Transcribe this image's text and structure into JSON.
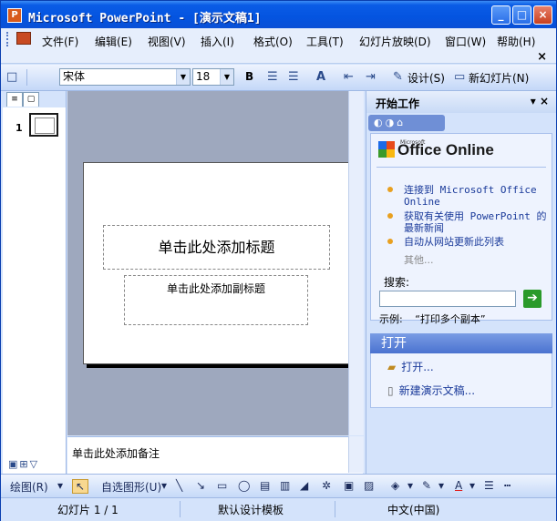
{
  "window": {
    "title": "Microsoft PowerPoint - [演示文稿1]",
    "app_icon": "powerpoint-icon",
    "controls": {
      "minimize": "_",
      "maximize": "□",
      "close": "×"
    }
  },
  "menubar": {
    "items": [
      "文件(F)",
      "编辑(E)",
      "视图(V)",
      "插入(I)",
      "格式(O)",
      "工具(T)",
      "幻灯片放映(D)",
      "窗口(W)",
      "帮助(H)"
    ],
    "close_doc": "×"
  },
  "toolbar": {
    "font_name": "宋体",
    "font_size": "18",
    "bold": "B",
    "design_label": "设计(S)",
    "new_slide_label": "新幻灯片(N)"
  },
  "slides_panel": {
    "slide_number": "1"
  },
  "slide": {
    "title_placeholder": "单击此处添加标题",
    "subtitle_placeholder": "单击此处添加副标题"
  },
  "notes": {
    "placeholder": "单击此处添加备注"
  },
  "task_pane": {
    "title": "开始工作",
    "logo_small": "Microsoft",
    "logo": "Office Online",
    "links": [
      "连接到 Microsoft Office Online",
      "获取有关使用 PowerPoint 的最新新闻",
      "自动从网站更新此列表"
    ],
    "other": "其他...",
    "search_label": "搜索:",
    "search_value": "",
    "example_label": "示例:",
    "example_text": "“打印多个副本”",
    "open_section_title": "打开",
    "open_items": [
      "打开...",
      "新建演示文稿..."
    ]
  },
  "drawbar": {
    "draw_label": "绘图(R)",
    "autoshapes_label": "自选图形(U)"
  },
  "statusbar": {
    "slide_info": "幻灯片 1 / 1",
    "design": "默认设计模板",
    "language": "中文(中国)"
  },
  "colors": {
    "title_bar": "#0a5ce6",
    "pane_bg": "#d4e3fb",
    "edit_bg": "#9ea8be",
    "link": "#1a3a9a",
    "bullet": "#e8a020"
  }
}
